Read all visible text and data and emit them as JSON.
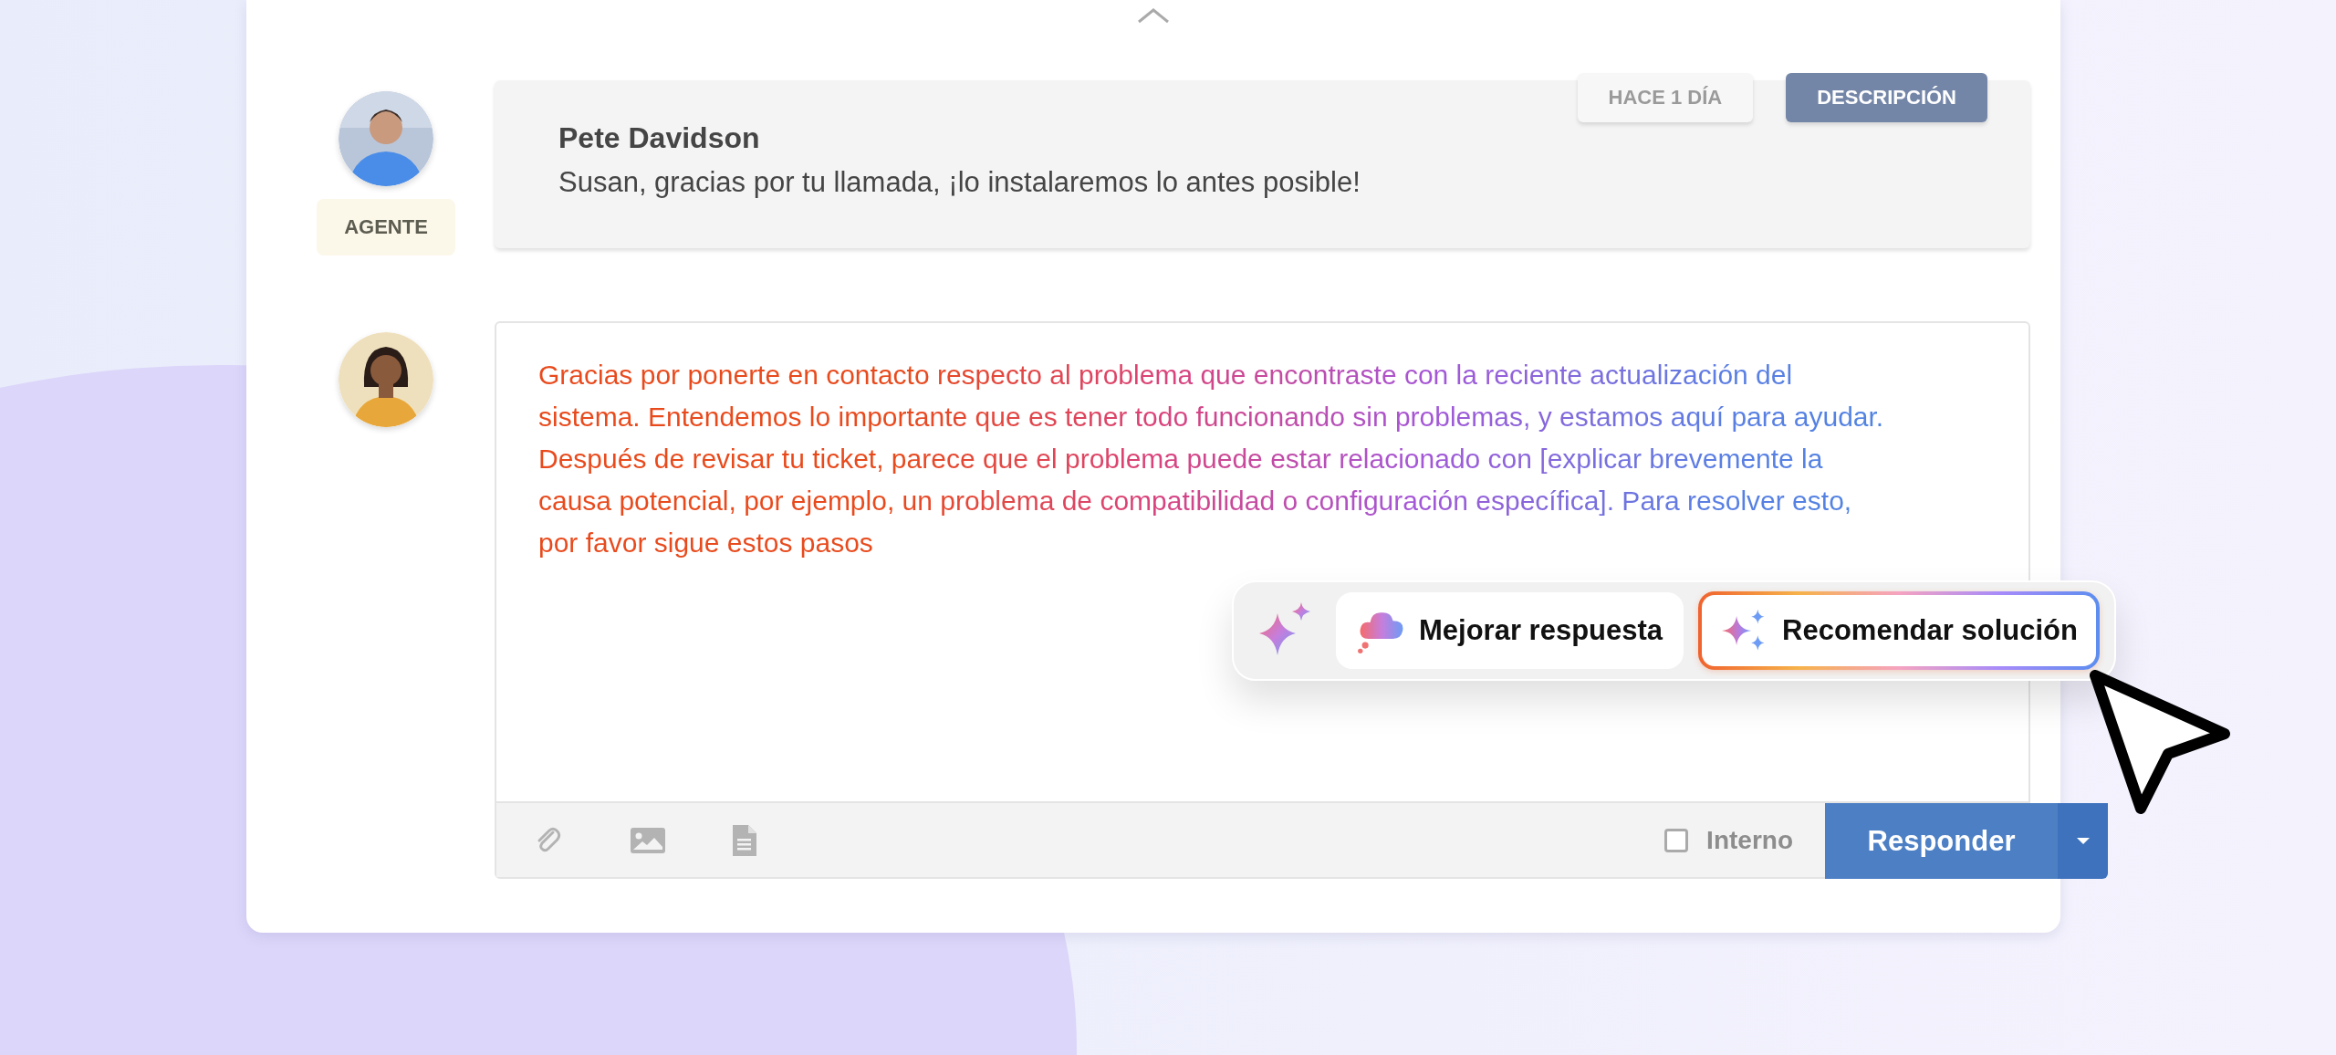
{
  "messages": [
    {
      "author": "Pete Davidson",
      "text": "Susan, gracias por tu llamada, ¡lo instalaremos lo antes posible!",
      "role_badge": "AGENTE",
      "tabs": [
        {
          "label": "HACE 1 DÍA",
          "selected": false
        },
        {
          "label": "DESCRIPCIÓN",
          "selected": true
        }
      ]
    }
  ],
  "reply": {
    "text": "Gracias por ponerte en contacto respecto al problema que encontraste con la reciente actualización del sistema. Entendemos lo importante que es tener todo funcionando sin problemas, y estamos aquí para ayudar. Después de revisar tu ticket, parece que el problema puede estar relacionado con [explicar brevemente la causa potencial, por ejemplo, un problema de compatibilidad o configuración específica]. Para resolver esto, por favor sigue estos pasos",
    "ai_actions": [
      {
        "label": "Mejorar respuesta",
        "kind": "improve",
        "selected": false
      },
      {
        "label": "Recomendar solución",
        "kind": "recommend",
        "selected": true
      }
    ],
    "internal": {
      "label": "Interno",
      "checked": false
    },
    "send_button": "Responder"
  }
}
